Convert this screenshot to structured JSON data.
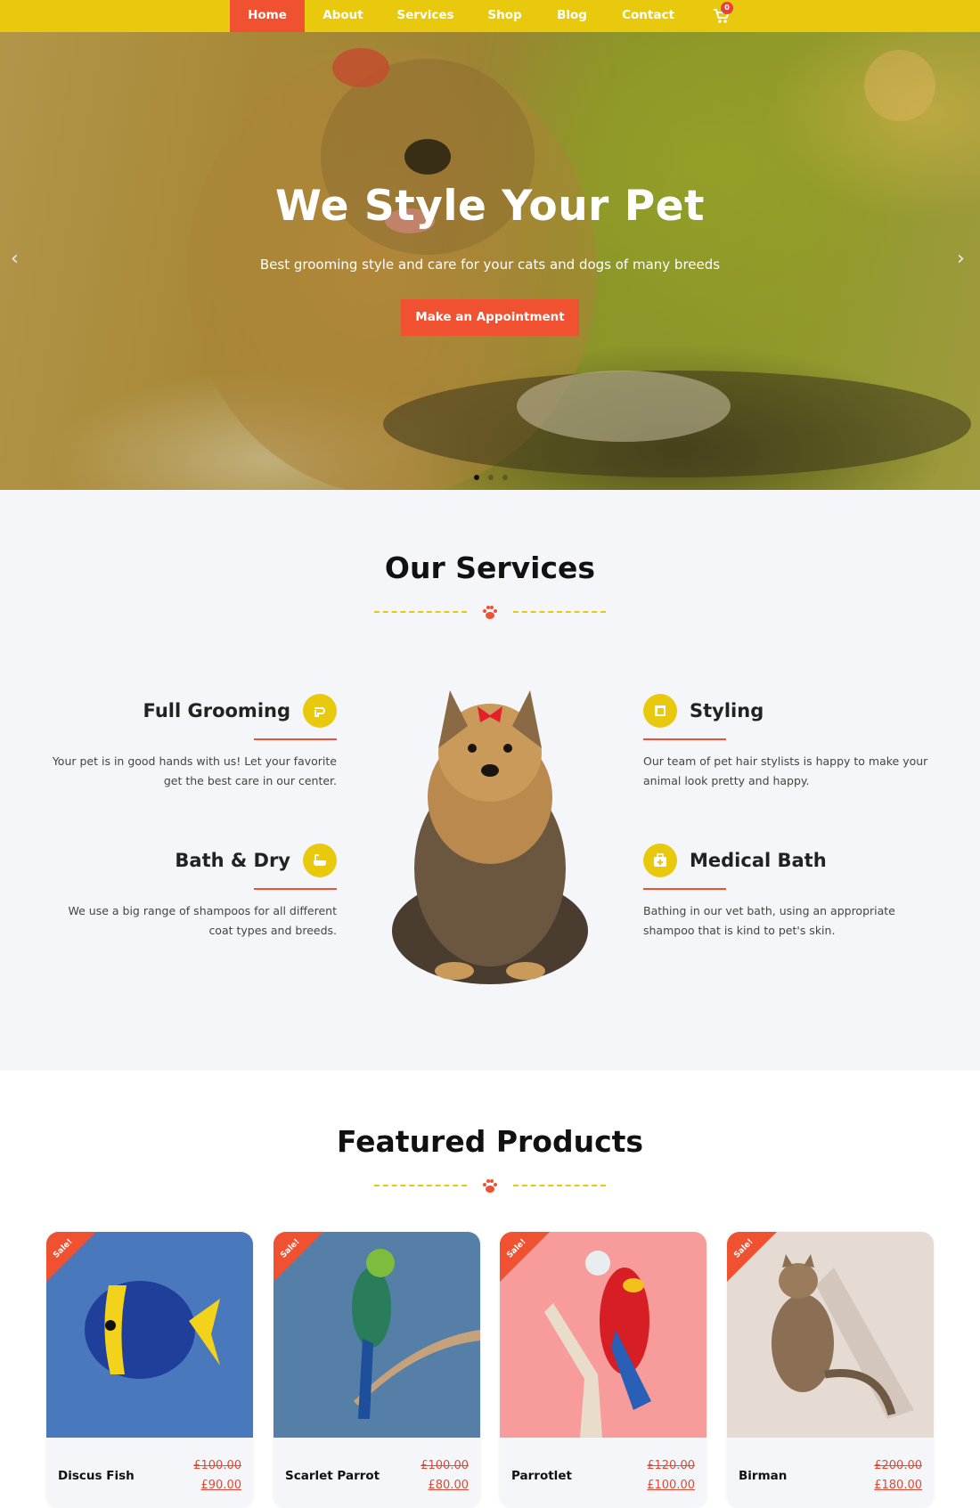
{
  "nav": {
    "items": [
      {
        "label": "Home",
        "active": true
      },
      {
        "label": "About"
      },
      {
        "label": "Services"
      },
      {
        "label": "Shop"
      },
      {
        "label": "Blog"
      },
      {
        "label": "Contact"
      }
    ],
    "cart_count": "0"
  },
  "hero": {
    "title": "We Style Your Pet",
    "subtitle": "Best grooming style and care for your cats and dogs of many breeds",
    "cta": "Make an Appointment",
    "prev_icon": "chevron-left-icon",
    "next_icon": "chevron-right-icon",
    "slides": 3,
    "active_slide": 1
  },
  "services": {
    "title": "Our Services",
    "items": [
      {
        "title": "Full Grooming",
        "icon": "grooming-hand-icon",
        "text": "Your pet is in good hands with us! Let your favorite get the best care in our center."
      },
      {
        "title": "Styling",
        "icon": "styling-frame-icon",
        "text": "Our team of pet hair stylists is happy to make your animal look pretty and happy."
      },
      {
        "title": "Bath & Dry",
        "icon": "bathtub-icon",
        "text": "We use a big range of shampoos for all different coat types and breeds."
      },
      {
        "title": "Medical Bath",
        "icon": "medical-kit-icon",
        "text": "Bathing in our vet bath, using an appropriate shampoo that is kind to pet's skin."
      }
    ]
  },
  "products": {
    "title": "Featured Products",
    "sale_label": "Sale!",
    "items": [
      {
        "name": "Discus Fish",
        "old_price": "£100.00",
        "price": "£90.00",
        "bg": "#4a78bd"
      },
      {
        "name": "Scarlet Parrot",
        "old_price": "£100.00",
        "price": "£80.00",
        "bg": "#557fa6"
      },
      {
        "name": "Parrotlet",
        "old_price": "£120.00",
        "price": "£100.00",
        "bg": "#f79b9b"
      },
      {
        "name": "Birman",
        "old_price": "£200.00",
        "price": "£180.00",
        "bg": "#e6dbd3"
      }
    ]
  },
  "colors": {
    "brand_yellow": "#e8c90e",
    "accent_red": "#ef5131",
    "section_bg": "#f5f6fa"
  }
}
